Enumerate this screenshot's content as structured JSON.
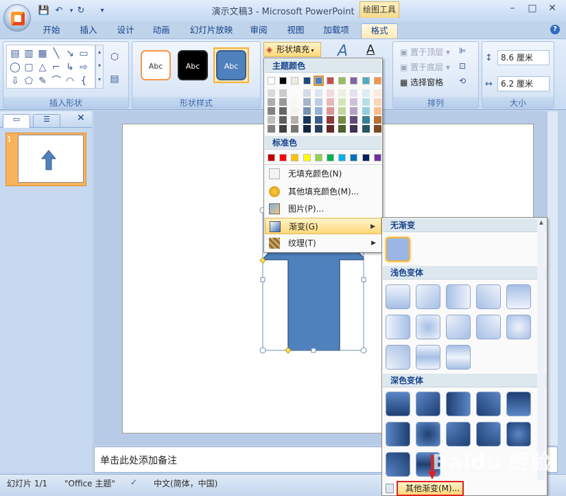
{
  "window": {
    "title": "演示文稿3 - Microsoft PowerPoint",
    "context_group": "绘图工具"
  },
  "tabs": [
    "开始",
    "插入",
    "设计",
    "动画",
    "幻灯片放映",
    "审阅",
    "视图",
    "加载项",
    "格式"
  ],
  "active_tab": "格式",
  "ribbon": {
    "insert_shapes_label": "插入形状",
    "shape_styles_label": "形状样式",
    "style_sample": "Abc",
    "shape_fill_button": "形状填充",
    "arrange_label": "排列",
    "bring_front": "置于顶层",
    "send_back": "置于底层",
    "selection_pane": "选择窗格",
    "size_label": "大小",
    "height_value": "8.6 厘米",
    "width_value": "6.2 厘米"
  },
  "fill_menu": {
    "theme_colors_header": "主题颜色",
    "standard_colors_header": "标准色",
    "no_fill": "无填充颜色(N)",
    "more_colors": "其他填充颜色(M)...",
    "picture": "图片(P)...",
    "gradient": "渐变(G)",
    "texture": "纹理(T)",
    "theme_colors": [
      "#ffffff",
      "#000000",
      "#eeece1",
      "#1f497d",
      "#4f81bd",
      "#c0504d",
      "#9bbb59",
      "#8064a2",
      "#4bacc6",
      "#f79646"
    ],
    "standard_colors": [
      "#c00000",
      "#ff0000",
      "#ffc000",
      "#ffff00",
      "#92d050",
      "#00b050",
      "#00b0f0",
      "#0070c0",
      "#002060",
      "#7030a0"
    ]
  },
  "gradient_menu": {
    "no_gradient_header": "无渐变",
    "light_header": "浅色变体",
    "dark_header": "深色变体",
    "more_gradients": "其他渐变(M)..."
  },
  "slide_pane": {
    "slide_number": "1"
  },
  "notes_placeholder": "单击此处添加备注",
  "statusbar": {
    "slide": "幻灯片 1/1",
    "theme": "\"Office 主题\"",
    "language": "中文(简体，中国)"
  },
  "watermark": {
    "text": "Baidu 经验",
    "sub": "jingyan.baidu.com"
  }
}
